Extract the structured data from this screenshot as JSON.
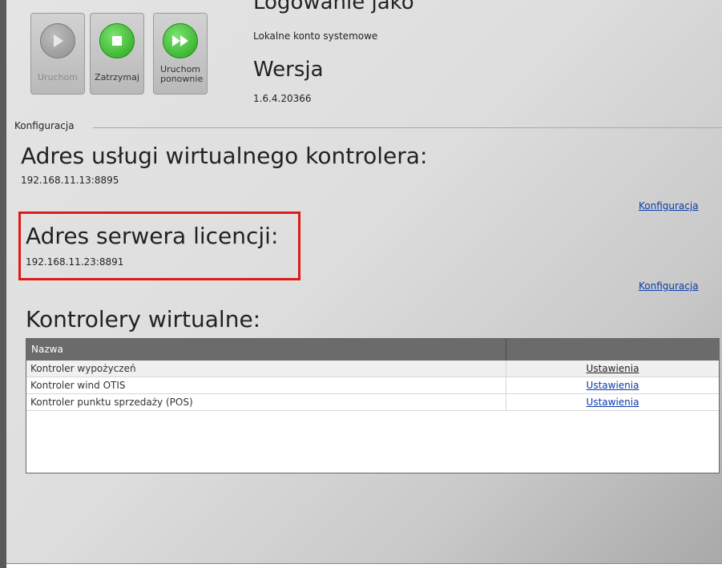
{
  "toolbar": {
    "start_label": "Uruchom",
    "stop_label": "Zatrzymaj",
    "restart_label": "Uruchom ponownie"
  },
  "service": {
    "logon_heading": "Logowanie jako",
    "logon_value": "Lokalne konto systemowe",
    "version_heading": "Wersja",
    "version_value": "1.6.4.20366"
  },
  "config": {
    "group_label": "Konfiguracja",
    "vc_address_heading": "Adres usługi wirtualnego kontrolera:",
    "vc_address_value": "192.168.11.13:8895",
    "vc_config_link": "Konfiguracja",
    "license_heading": "Adres serwera licencji:",
    "license_value": "192.168.11.23:8891",
    "license_config_link": "Konfiguracja"
  },
  "controllers": {
    "heading": "Kontrolery wirtualne:",
    "column_name": "Nazwa",
    "rows": [
      {
        "name": "Kontroler wypożyczeń",
        "action": "Ustawienia"
      },
      {
        "name": "Kontroler wind OTIS",
        "action": "Ustawienia"
      },
      {
        "name": "Kontroler punktu sprzedaży (POS)",
        "action": "Ustawienia"
      }
    ]
  },
  "colors": {
    "link": "#0a3aa8",
    "highlight_border": "#e01a1a",
    "table_header": "#6b6b6b",
    "button_green": "#26a51c"
  }
}
